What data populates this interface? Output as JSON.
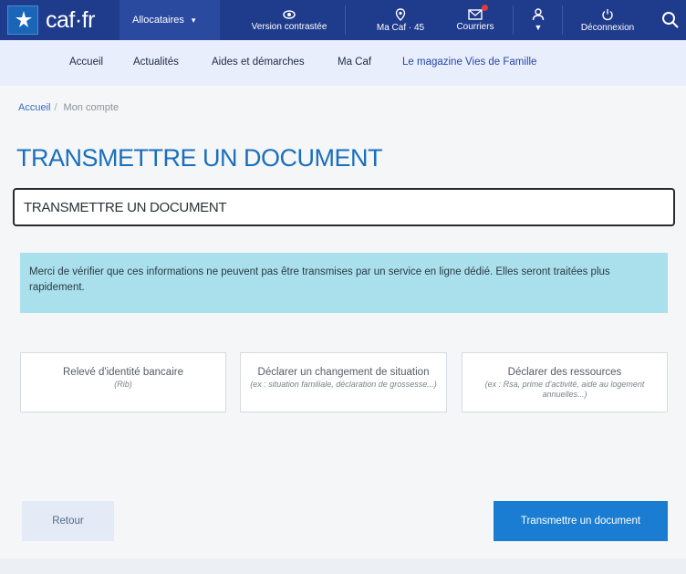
{
  "header": {
    "logo_text": "caf·fr",
    "audience_dropdown": "Allocataires",
    "items": [
      {
        "label": "Version contrastée",
        "icon": "eye-icon"
      },
      {
        "label": "Ma Caf · 45",
        "icon": "location-pin-icon"
      },
      {
        "label": "Courriers",
        "icon": "mail-icon"
      },
      {
        "label": "",
        "icon": "user-icon"
      },
      {
        "label": "Déconnexion",
        "icon": "power-icon"
      }
    ],
    "search_icon": "search-icon",
    "colors": {
      "bar": "#1f3b8c",
      "notification": "#e23a3a"
    }
  },
  "nav": {
    "items": [
      "Accueil",
      "Actualités",
      "Aides et démarches",
      "Ma Caf",
      "Le magazine Vies de Famille"
    ]
  },
  "breadcrumb": {
    "home": "Accueil",
    "separator": "/",
    "current": "Mon compte"
  },
  "page": {
    "title": "TRANSMETTRE UN DOCUMENT",
    "document_field": "TRANSMETTRE UN DOCUMENT",
    "info_text": "Merci de vérifier que ces informations ne peuvent pas être transmises par un service en ligne dédié. Elles seront traitées plus rapidement."
  },
  "cards": [
    {
      "title": "Relevé d'identité bancaire",
      "subtitle": "(Rib)"
    },
    {
      "title": "Déclarer un changement de situation",
      "subtitle": "(ex : situation familiale, déclaration de grossesse...)"
    },
    {
      "title": "Déclarer des ressources",
      "subtitle": "(ex : Rsa, prime d'activité, aide au logement annuelles...)"
    }
  ],
  "actions": {
    "back": "Retour",
    "submit": "Transmettre un document"
  },
  "accent_colors": {
    "title": "#1a6fbc",
    "info_bg": "#a9e0ec",
    "primary_button": "#1b7dd1"
  }
}
